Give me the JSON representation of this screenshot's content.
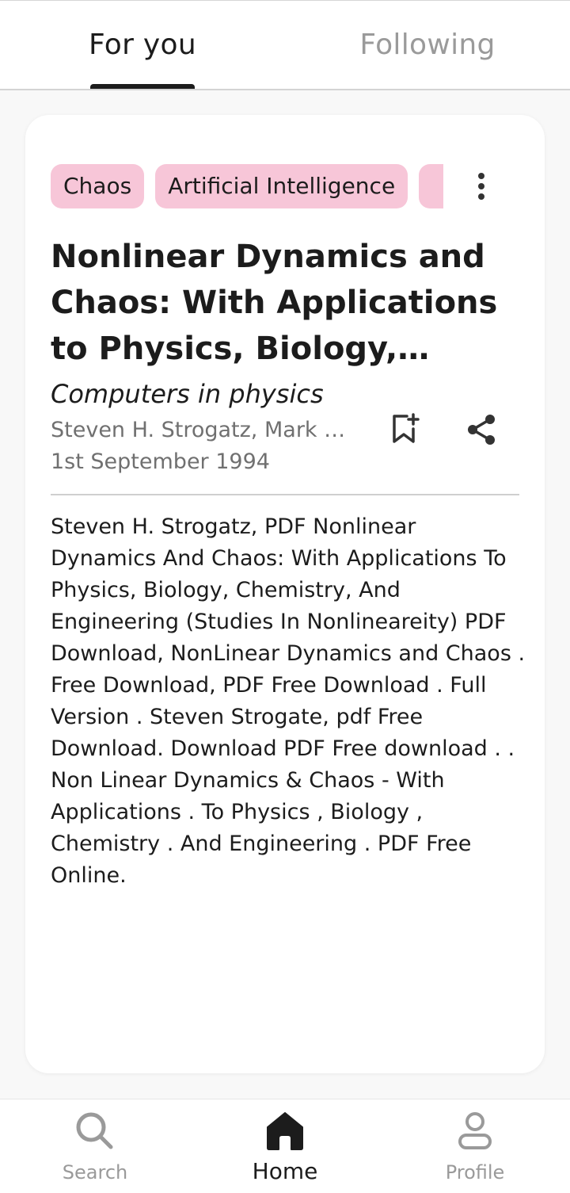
{
  "tabs": {
    "for_you": "For you",
    "following": "Following"
  },
  "card": {
    "tags": [
      "Chaos",
      "Artificial Intelligence",
      ""
    ],
    "title": "Nonlinear Dynamics and Chaos: With Applications to Physics, Biology, Chemistry, …",
    "journal": "Computers in physics",
    "authors": "Steven H. Strogatz, Mark …",
    "date": "1st September 1994",
    "abstract": "Steven H. Strogatz, PDF Nonlinear Dynamics And Chaos: With Applications To Physics, Biology, Chemistry, And Engineering (Studies In Nonlineareity) PDF Download, NonLinear Dynamics and Chaos . Free Download, PDF Free Download . Full Version . Steven Strogate, pdf Free Download. Download PDF Free download . . Non Linear Dynamics & Chaos - With Applications . To Physics , Biology , Chemistry . And Engineering . PDF Free Online."
  },
  "icons": {
    "more": "more-vertical-icon",
    "bookmark": "bookmark-add-icon",
    "share": "share-icon",
    "search": "search-icon",
    "home": "home-icon",
    "profile": "profile-icon"
  },
  "bottom_nav": {
    "search": "Search",
    "home": "Home",
    "profile": "Profile"
  },
  "colors": {
    "tag_background": "#f7c6d8",
    "active": "#1c1c1c",
    "inactive": "#9a9a9a"
  }
}
